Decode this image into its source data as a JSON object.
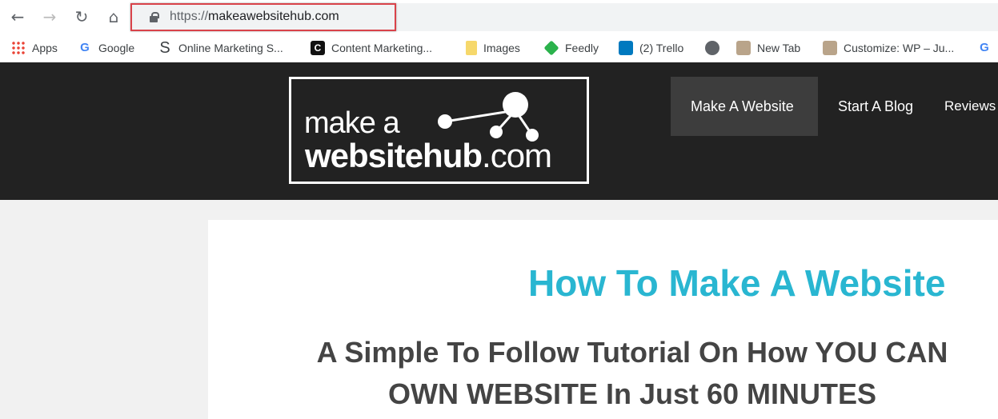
{
  "browser": {
    "url_prefix": "https://",
    "url_host": "makeawebsitehub.com",
    "bookmarks": [
      {
        "label": "Apps",
        "icon": "apps-grid-icon"
      },
      {
        "label": "Google",
        "icon": "google-icon"
      },
      {
        "label": "Online Marketing S...",
        "icon": "s-icon"
      },
      {
        "label": "Content Marketing...",
        "icon": "c-icon"
      },
      {
        "label": "Images",
        "icon": "folder-icon"
      },
      {
        "label": "Feedly",
        "icon": "feedly-icon"
      },
      {
        "label": "(2) Trello",
        "icon": "trello-icon"
      },
      {
        "label": "",
        "icon": "globe-icon"
      },
      {
        "label": "New Tab",
        "icon": "tree-icon"
      },
      {
        "label": "Customize: WP – Ju...",
        "icon": "tree-icon"
      },
      {
        "label": "",
        "icon": "google-icon"
      }
    ]
  },
  "site": {
    "logo": {
      "line1": "make a",
      "line2": "websitehub",
      "line2_suffix": ".com"
    },
    "nav": [
      "Make A Website",
      "Start A Blog",
      "Reviews"
    ],
    "title": "How To Make A Website",
    "subtitle_line1": "A Simple To Follow Tutorial On How YOU CAN",
    "subtitle_line2": "OWN WEBSITE In Just 60 MINUTES"
  },
  "colors": {
    "accent": "#29b6d1",
    "header": "#222222",
    "highlight": "#d9434a"
  }
}
